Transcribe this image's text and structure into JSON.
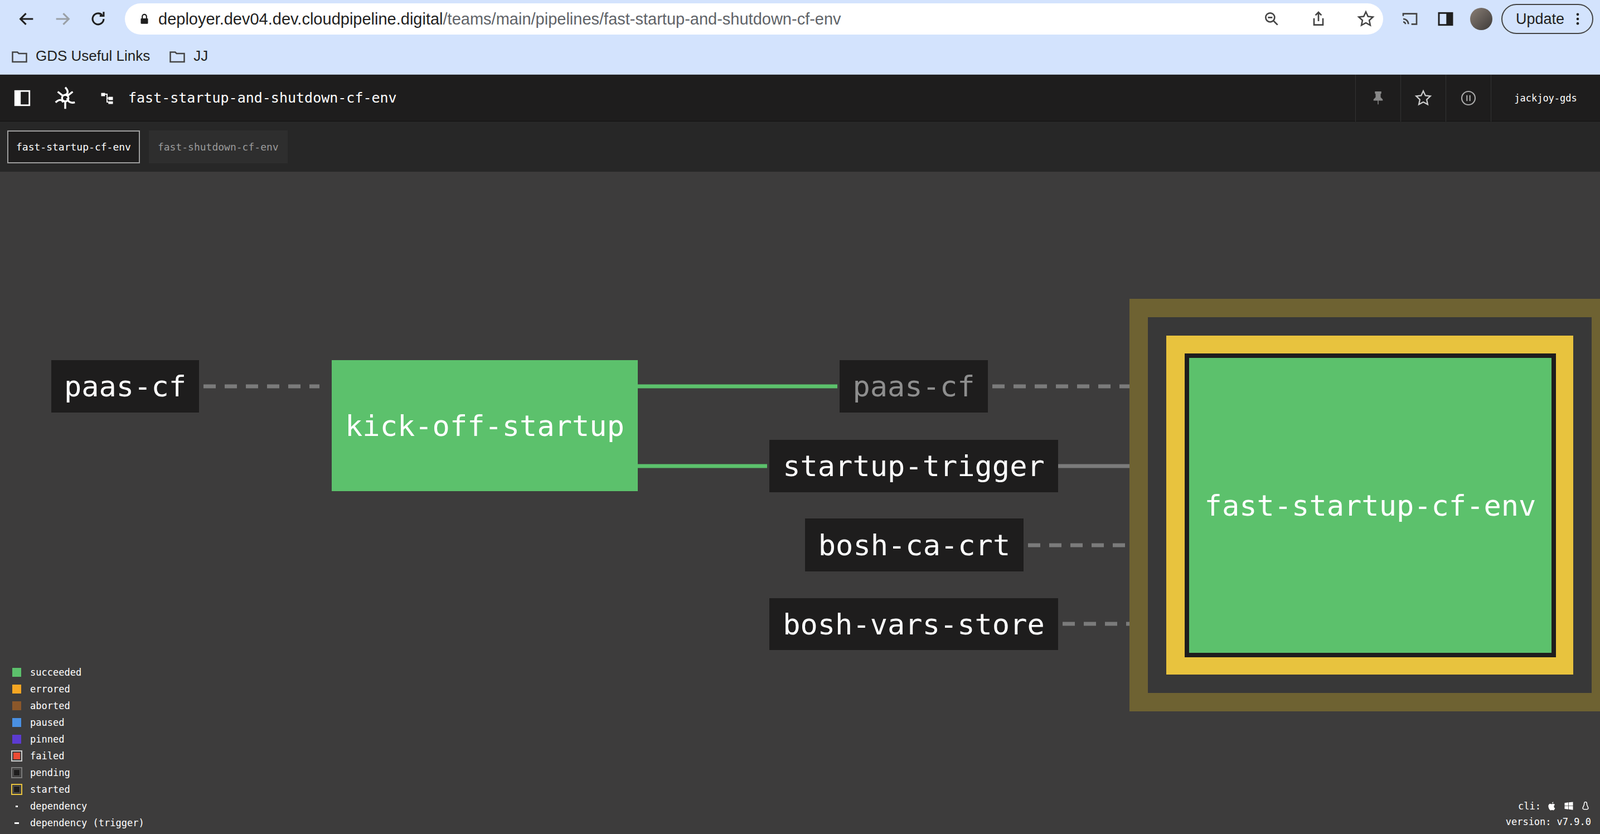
{
  "browser": {
    "url_host": "deployer.dev04.dev.cloudpipeline.digital",
    "url_path": "/teams/main/pipelines/fast-startup-and-shutdown-cf-env",
    "forward_enabled": false,
    "update_button": "Update"
  },
  "bookmarks": [
    {
      "label": "GDS Useful Links"
    },
    {
      "label": "JJ"
    }
  ],
  "topbar": {
    "pipeline": "fast-startup-and-shutdown-cf-env",
    "user": "jackjoy-gds"
  },
  "groups": [
    {
      "label": "fast-startup-cf-env",
      "selected": true
    },
    {
      "label": "fast-shutdown-cf-env",
      "selected": false
    }
  ],
  "nodes": [
    {
      "label": "paas-cf",
      "kind": "resource",
      "dimmed": false
    },
    {
      "label": "kick-off-startup",
      "kind": "job",
      "status": "succeeded",
      "running": false
    },
    {
      "label": "paas-cf",
      "kind": "resource",
      "dimmed": true
    },
    {
      "label": "startup-trigger",
      "kind": "resource",
      "dimmed": false
    },
    {
      "label": "bosh-ca-crt",
      "kind": "resource",
      "dimmed": false
    },
    {
      "label": "bosh-vars-store",
      "kind": "resource",
      "dimmed": false
    },
    {
      "label": "fast-startup-cf-env",
      "kind": "job",
      "status": "succeeded",
      "running": true
    }
  ],
  "edges": [
    {
      "from": 0,
      "to": 1,
      "trigger": false,
      "color": "#7b7b7b"
    },
    {
      "from": 1,
      "to": 2,
      "trigger": true,
      "color": "#5cc16c"
    },
    {
      "from": 1,
      "to": 3,
      "trigger": true,
      "color": "#5cc16c"
    },
    {
      "from": 2,
      "to": 6,
      "trigger": false,
      "color": "#7b7b7b"
    },
    {
      "from": 3,
      "to": 6,
      "trigger": true,
      "color": "#7b7b7b"
    },
    {
      "from": 4,
      "to": 6,
      "trigger": false,
      "color": "#7b7b7b"
    },
    {
      "from": 5,
      "to": 6,
      "trigger": false,
      "color": "#7b7b7b"
    }
  ],
  "legend": [
    {
      "label": "succeeded",
      "kind": "fill",
      "color": "#5cc16c"
    },
    {
      "label": "errored",
      "kind": "fill",
      "color": "#f5a623"
    },
    {
      "label": "aborted",
      "kind": "fill",
      "color": "#8b572a"
    },
    {
      "label": "paused",
      "kind": "fill",
      "color": "#4a90e2"
    },
    {
      "label": "pinned",
      "kind": "fill",
      "color": "#5c3bd1"
    },
    {
      "label": "failed",
      "kind": "framed",
      "color": "#ed4b35"
    },
    {
      "label": "pending",
      "kind": "outline",
      "color": "#7b7b7b"
    },
    {
      "label": "started",
      "kind": "outline",
      "color": "#e8c33e"
    },
    {
      "label": "dependency",
      "kind": "dashed",
      "color": "#ffffff"
    },
    {
      "label": "dependency (trigger)",
      "kind": "solid",
      "color": "#ffffff"
    }
  ],
  "footer": {
    "cli_label": "cli:",
    "version_label": "version:",
    "version": "v7.9.0"
  }
}
